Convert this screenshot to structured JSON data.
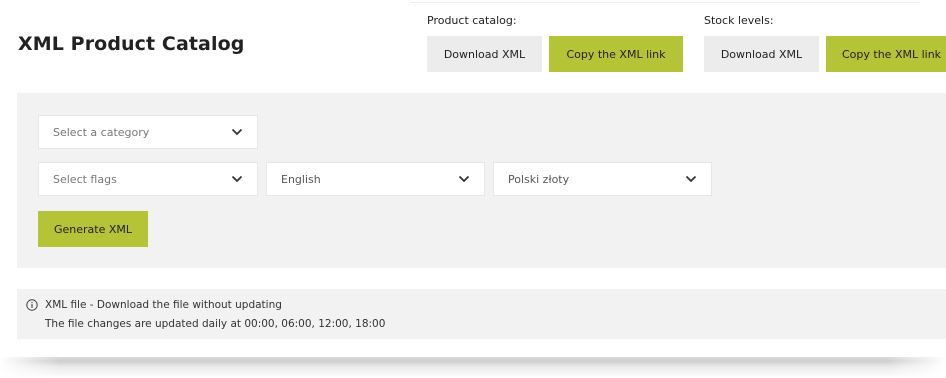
{
  "page": {
    "title": "XML Product Catalog"
  },
  "product_catalog": {
    "label": "Product catalog:",
    "download_label": "Download XML",
    "copy_label": "Copy the XML link"
  },
  "stock_levels": {
    "label": "Stock levels:",
    "download_label": "Download XML",
    "copy_label": "Copy the XML link"
  },
  "filters": {
    "category_placeholder": "Select a category",
    "flags_placeholder": "Select flags",
    "language_value": "English",
    "currency_value": "Polski złoty",
    "generate_label": "Generate XML",
    "chevron_icon": "chevron-down-icon"
  },
  "info": {
    "icon": "info-icon",
    "line1": "XML file - Download the file without updating",
    "line2": "The file changes are updated daily at 00:00, 06:00, 12:00, 18:00"
  },
  "colors": {
    "accent_green": "#b5c437",
    "button_grey": "#ececec",
    "panel_grey": "#f2f2f2"
  }
}
